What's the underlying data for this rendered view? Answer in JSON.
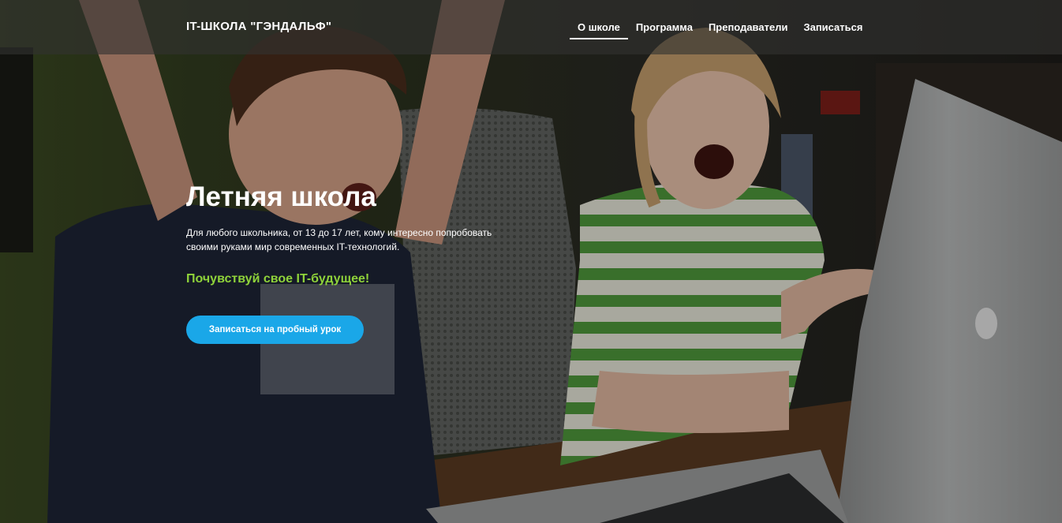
{
  "header": {
    "brand": "IT-ШКОЛА \"ГЭНДАЛЬФ\"",
    "nav": [
      {
        "label": "О школе",
        "active": true
      },
      {
        "label": "Программа",
        "active": false
      },
      {
        "label": "Преподаватели",
        "active": false
      },
      {
        "label": "Записаться",
        "active": false
      }
    ]
  },
  "hero": {
    "title": "Летняя школа",
    "description": "Для любого школьника, от 13 до 17 лет, кому интересно попробовать своими руками мир современных IT-технологий.",
    "tagline": "Почувствуй свое IT-будущее!",
    "cta_label": "Записаться на пробный урок"
  },
  "colors": {
    "accent_green": "#8fd33a",
    "button_blue": "#1aa7e8"
  }
}
